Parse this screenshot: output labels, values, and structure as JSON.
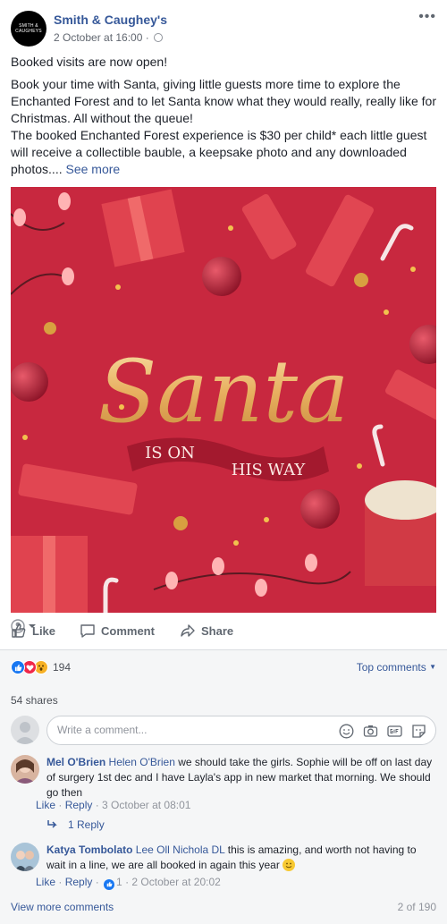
{
  "post": {
    "page_name": "Smith & Caughey's",
    "logo_text": "SMITH & CAUGHEYS",
    "timestamp": "2 October at 16:00 ·",
    "more_options": "•••",
    "heading": "Booked visits are now open!",
    "body": "Book your time with Santa, giving little guests more time to explore the Enchanted Forest and to let Santa know what they would really, really like for Christmas. All without the queue!\nThe booked Enchanted Forest experience is $30 per child* each little guest will receive a collectible bauble, a keepsake photo and any downloaded photos....",
    "see_more": "See more"
  },
  "image": {
    "title_script": "Santa",
    "banner_left": "IS ON",
    "banner_right": "HIS WAY",
    "background_color": "#c8283f"
  },
  "actions": {
    "like": "Like",
    "comment": "Comment",
    "share": "Share"
  },
  "reactions": {
    "count": "194",
    "top_comments": "Top comments",
    "icons": [
      "like-icon",
      "love-icon",
      "wow-icon"
    ]
  },
  "shares": "54 shares",
  "composer": {
    "placeholder": "Write a comment..."
  },
  "comments": [
    {
      "author": "Mel O'Brien",
      "tag": "Helen O'Brien",
      "text": " we should take the girls. Sophie will be off on last day of surgery 1st dec and I have Layla's app in new market that morning. We should go then",
      "like": "Like",
      "reply": "Reply",
      "time": "3 October at 08:01",
      "replies": "1 Reply"
    },
    {
      "author": "Katya Tombolato",
      "tag": "Lee Oll Nichola DL",
      "text": " this is amazing, and worth not having to wait in a line, we are all booked in again this year",
      "like": "Like",
      "reply": "Reply",
      "like_count": "1",
      "time": "2 October at 20:02"
    }
  ],
  "footer": {
    "view_more": "View more comments",
    "page_count": "2 of 190"
  }
}
